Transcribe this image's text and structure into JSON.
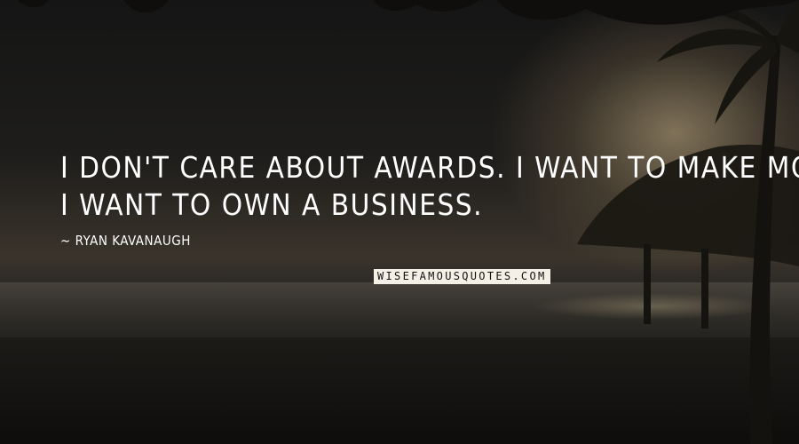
{
  "quote": {
    "line1": "I don't care about awards. I want to make money.",
    "line2": "I want to own a business.",
    "author": "~ Ryan Kavanaugh"
  },
  "watermark": "WISEFAMOUSQUOTES.COM",
  "colors": {
    "text": "#ffffff",
    "watermark_bg": "#f4f0e6",
    "watermark_text": "#111111"
  }
}
